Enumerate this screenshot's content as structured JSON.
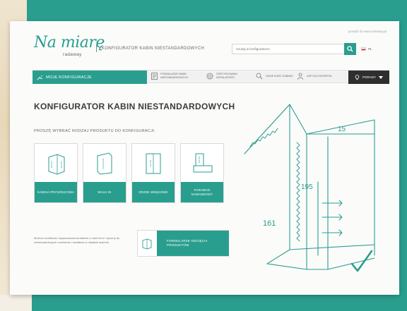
{
  "site": {
    "logo_main": "Na miarę",
    "logo_sub": "radaway",
    "header_title": "KONFIGURATOR KABIN NIESTANDARDOWYCH",
    "top_link": "przejdź do www.radaway.pl"
  },
  "search": {
    "placeholder": "Szukaj w konfiguratorze"
  },
  "language": {
    "code": "PL"
  },
  "nav": {
    "my_configurations": "MOJE KONFIGURACJE",
    "items": [
      {
        "label": "FORMULARZE KABIN NIESTANDARDOWYCH",
        "icon": "form-icon"
      },
      {
        "label": "CERTYFIKOWANI INSTALATORZY",
        "icon": "certificate-icon"
      },
      {
        "label": "GDZIE KUPIĆ KABINĘ?",
        "icon": "search-store-icon"
      },
      {
        "label": "ZAPYTAJ EKSPERTA",
        "icon": "expert-icon"
      }
    ],
    "products": "PORADY"
  },
  "main": {
    "heading": "KONFIGURATOR KABIN NIESTANDARDOWYCH",
    "select_label": "PROSZĘ WYBRAĆ RODZAJ PRODUKTU DO KONFIGURACJI:",
    "products": [
      {
        "label": "KABINA PRYSZNICOWA",
        "icon": "shower-cabin-icon"
      },
      {
        "label": "WALK-IN",
        "icon": "walk-in-icon"
      },
      {
        "label": "DRZWI WNĘKOWE",
        "icon": "niche-door-icon"
      },
      {
        "label": "PARAWAN NAWANNOWY",
        "icon": "bath-screen-icon"
      }
    ],
    "info_text": "Możesz możliwość dopasowania kontaktów z nami form i wyceny do niestandardowych rozmiarów i kształtów w układzie łazienki.",
    "order_form": "FORMULARZE ODCIĘCIA PRODUKTÓW"
  },
  "sketch": {
    "dim_top": "15",
    "dim_height": "195",
    "dim_side": "161"
  },
  "colors": {
    "accent": "#2a9e8e",
    "dark": "#2e2e2e",
    "text": "#3c3c3c"
  }
}
